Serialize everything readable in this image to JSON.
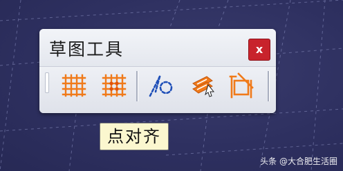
{
  "toolbar": {
    "title": "草图工具",
    "close_label": "x",
    "tools": [
      {
        "name": "grid-icon"
      },
      {
        "name": "snap-to-point-icon"
      },
      {
        "name": "construction-element-icon"
      },
      {
        "name": "geometric-constraint-icon"
      },
      {
        "name": "dimensional-constraint-icon"
      }
    ]
  },
  "tooltip": {
    "text": "点对齐"
  },
  "watermark": {
    "text": "头条 @大合肥生活圈"
  },
  "colors": {
    "background": "#30325f",
    "accent_orange": "#f07a1a",
    "accent_blue": "#1f4fb8",
    "close_red": "#c8232c",
    "tooltip_bg": "#fbf7cf"
  }
}
